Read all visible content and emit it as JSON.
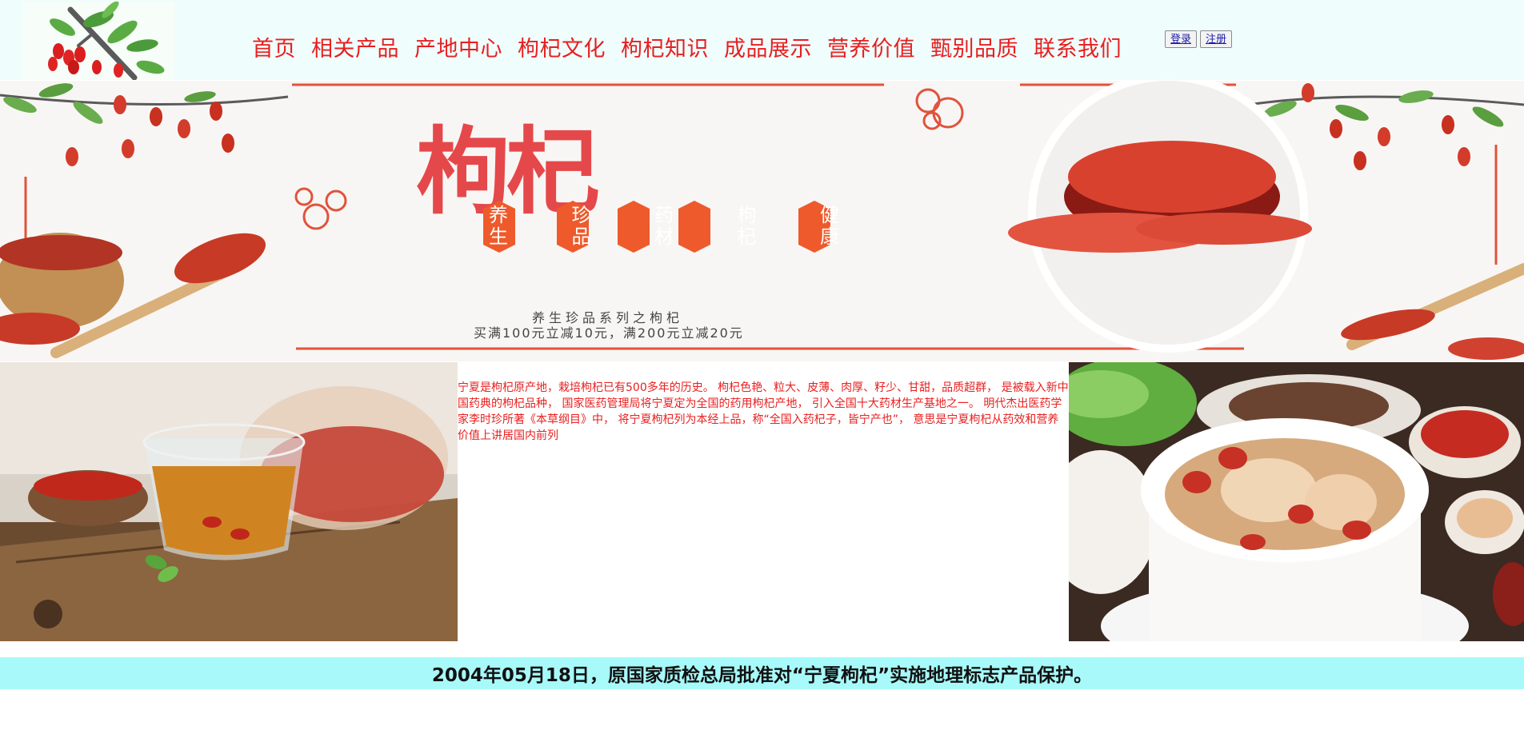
{
  "nav": {
    "items": [
      {
        "label": "首页"
      },
      {
        "label": "相关产品"
      },
      {
        "label": "产地中心"
      },
      {
        "label": "枸杞文化"
      },
      {
        "label": "枸杞知识"
      },
      {
        "label": "成品展示"
      },
      {
        "label": "营养价值"
      },
      {
        "label": "甄别品质"
      },
      {
        "label": "联系我们"
      }
    ],
    "login_label": "登录",
    "register_label": "注册"
  },
  "banner": {
    "title": "枸杞",
    "tags": [
      "养生",
      "珍品",
      "药材",
      "枸杞",
      "健康"
    ],
    "subtitle": "养生珍品系列之枸杞",
    "promo": "买满100元立减10元，满200元立减20元"
  },
  "intro": {
    "text": "宁夏是枸杞原产地，栽培枸杞已有500多年的历史。 枸杞色艳、粒大、皮薄、肉厚、籽少、甘甜，品质超群， 是被载入新中国药典的枸杞品种， 国家医药管理局将宁夏定为全国的药用枸杞产地， 引入全国十大药材生产基地之一。 明代杰出医药学家李时珍所著《本草纲目》中， 将宁夏枸杞列为本经上品，称“全国入药杞子，皆宁产也”， 意思是宁夏枸杞从药效和营养价值上讲居国内前列"
  },
  "notice": {
    "text": "2004年05月18日，原国家质检总局批准对“宁夏枸杞”实施地理标志产品保护。"
  },
  "colors": {
    "accent": "#e81f1f",
    "header_bg": "#effdfd",
    "notice_bg": "#a8fafa"
  }
}
